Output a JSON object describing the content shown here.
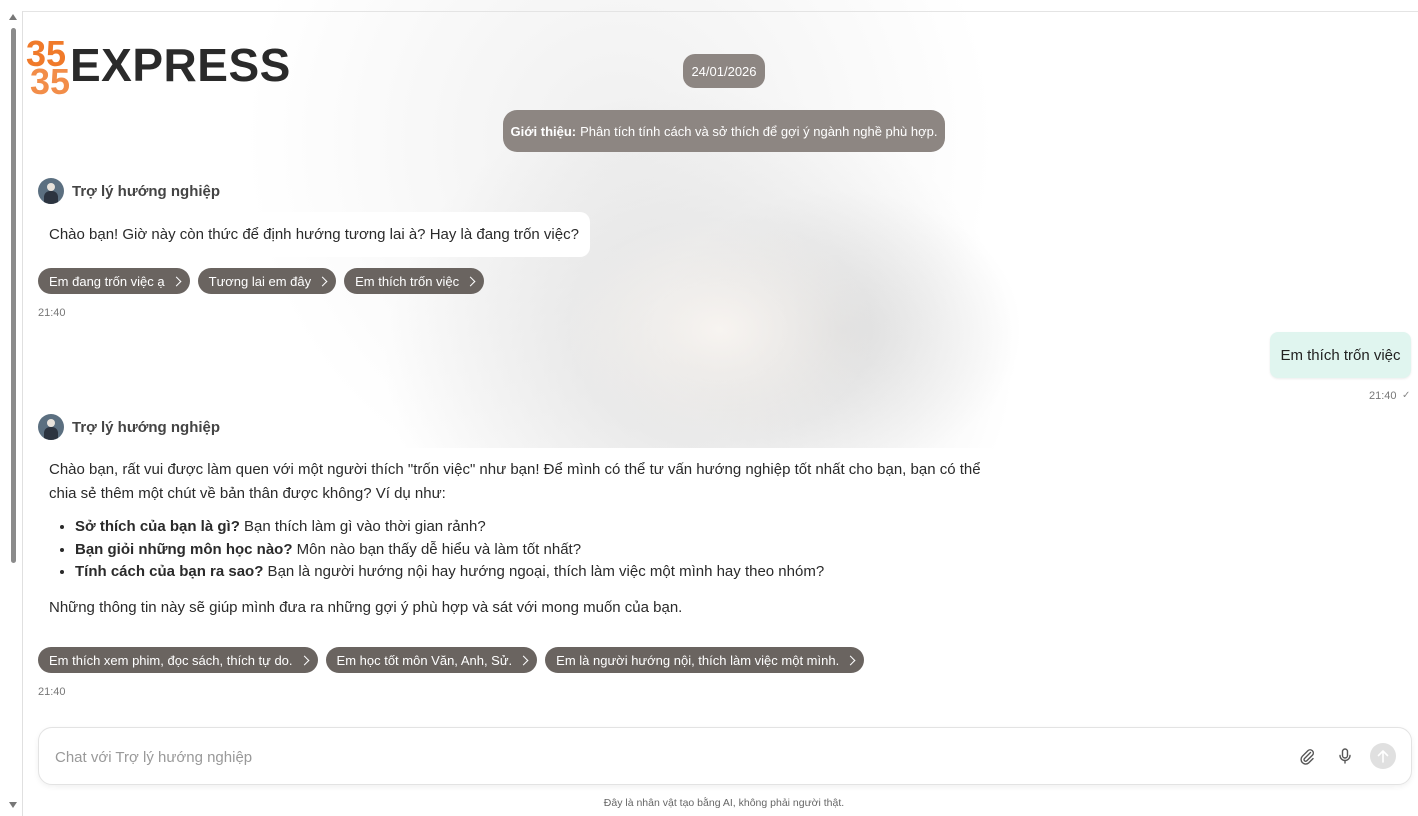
{
  "brand": {
    "logo_text": "EXPRESS",
    "logo_mark_text": "35",
    "logo_color": "#f07a2a"
  },
  "date_label": "24/01/2026",
  "intro": {
    "label": "Giới thiệu:",
    "text": "Phân tích tính cách và sở thích để gợi ý ngành nghề phù hợp."
  },
  "assistant_name": "Trợ lý hướng nghiệp",
  "messages": [
    {
      "text": "Chào bạn! Giờ này còn thức để định hướng tương lai à? Hay là đang trốn việc?",
      "suggestions": [
        "Em đang trốn việc ạ",
        "Tương lai em đây",
        "Em thích trốn việc"
      ],
      "time": "21:40"
    },
    {
      "intro": "Chào bạn, rất vui được làm quen với một người thích \"trốn việc\" như bạn! Để mình có thể tư vấn hướng nghiệp tốt nhất cho bạn, bạn có thể chia sẻ thêm một chút về bản thân được không? Ví dụ như:",
      "bullets": [
        {
          "bold": "Sở thích của bạn là gì?",
          "text": " Bạn thích làm gì vào thời gian rảnh?"
        },
        {
          "bold": "Bạn giỏi những môn học nào?",
          "text": " Môn nào bạn thấy dễ hiểu và làm tốt nhất?"
        },
        {
          "bold": "Tính cách của bạn ra sao?",
          "text": " Bạn là người hướng nội hay hướng ngoại, thích làm việc một mình hay theo nhóm?"
        }
      ],
      "outro": "Những thông tin này sẽ giúp mình đưa ra những gợi ý phù hợp và sát với mong muốn của bạn.",
      "suggestions": [
        "Em thích xem phim, đọc sách, thích tự do.",
        "Em học tốt môn Văn, Anh, Sử.",
        "Em là người hướng nội, thích làm việc một mình."
      ],
      "time": "21:40"
    }
  ],
  "user_message": {
    "text": "Em thích trốn việc",
    "time": "21:40"
  },
  "input": {
    "placeholder": "Chat với Trợ lý hướng nghiệp",
    "value": ""
  },
  "icons": {
    "attach": "paperclip-icon",
    "mic": "microphone-icon",
    "send": "arrow-up-icon",
    "read": "check-icon"
  },
  "footer_note": "Đây là nhân vật tạo bằng AI, không phải người thật.",
  "colors": {
    "chip_bg": "#6a6460",
    "pill_bg": "#8d8682",
    "user_bubble_bg": "#e0f5ef"
  }
}
